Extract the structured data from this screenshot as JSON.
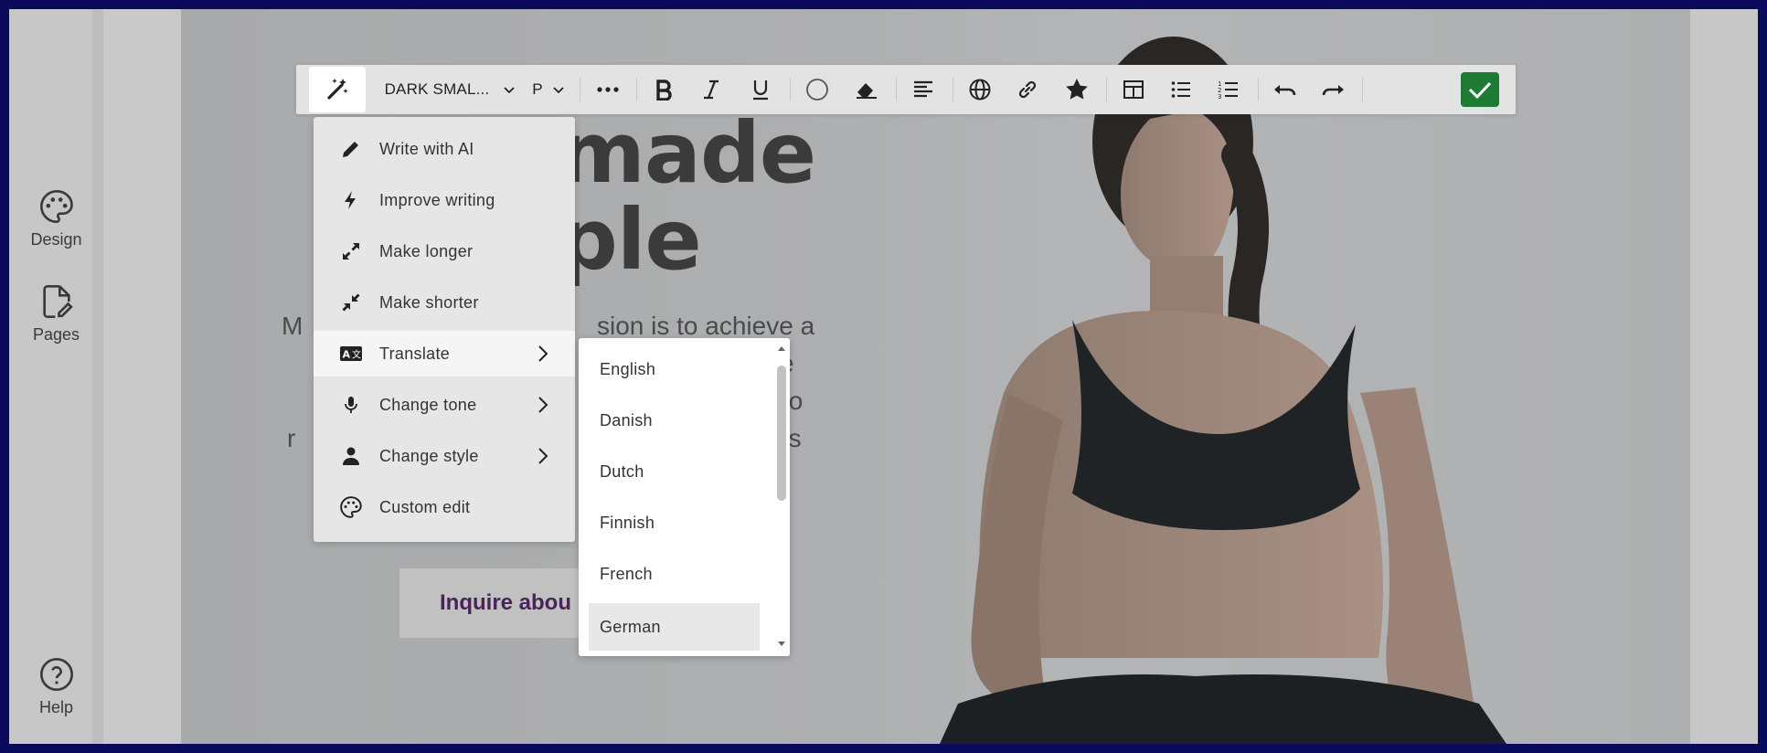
{
  "sidebar": {
    "items": [
      {
        "label": "Design",
        "icon": "palette-icon"
      },
      {
        "label": "Pages",
        "icon": "page-edit-icon"
      }
    ],
    "help_label": "Help"
  },
  "toolbar": {
    "font_style": "DARK SMAL...",
    "paragraph": "P",
    "icons": [
      "ai-magic-wand-icon",
      "chevron-down-icon",
      "more-icon",
      "bold-icon",
      "italic-icon",
      "underline-icon",
      "color-circle-icon",
      "eraser-icon",
      "align-left-icon",
      "globe-icon",
      "link-icon",
      "star-icon",
      "table-icon",
      "bullet-list-icon",
      "numbered-list-icon",
      "undo-icon",
      "redo-icon",
      "check-icon"
    ],
    "confirm_color": "#1f7a34"
  },
  "hero": {
    "title_line1": "made",
    "title_line2": "ple",
    "paragraph_fragments": [
      "M",
      "sion is to achieve a",
      "e",
      "to",
      "r",
      "ses",
      "r"
    ],
    "cta_label": "Inquire abou"
  },
  "ai_menu": {
    "items": [
      {
        "label": "Write with AI",
        "icon": "pencil-icon",
        "submenu": false
      },
      {
        "label": "Improve writing",
        "icon": "lightning-icon",
        "submenu": false
      },
      {
        "label": "Make longer",
        "icon": "expand-icon",
        "submenu": false
      },
      {
        "label": "Make shorter",
        "icon": "collapse-icon",
        "submenu": false
      },
      {
        "label": "Translate",
        "icon": "translate-icon",
        "submenu": true
      },
      {
        "label": "Change tone",
        "icon": "microphone-icon",
        "submenu": true
      },
      {
        "label": "Change style",
        "icon": "person-icon",
        "submenu": true
      },
      {
        "label": "Custom edit",
        "icon": "palette-icon",
        "submenu": false
      }
    ],
    "active_item": "Translate"
  },
  "languages": {
    "options": [
      "English",
      "Danish",
      "Dutch",
      "Finnish",
      "French",
      "German"
    ],
    "selected": "German"
  },
  "colors": {
    "outer_border": "#0a0a5c",
    "scroll_top_button": "#4a1f4d",
    "cta_text": "#4a2458"
  }
}
